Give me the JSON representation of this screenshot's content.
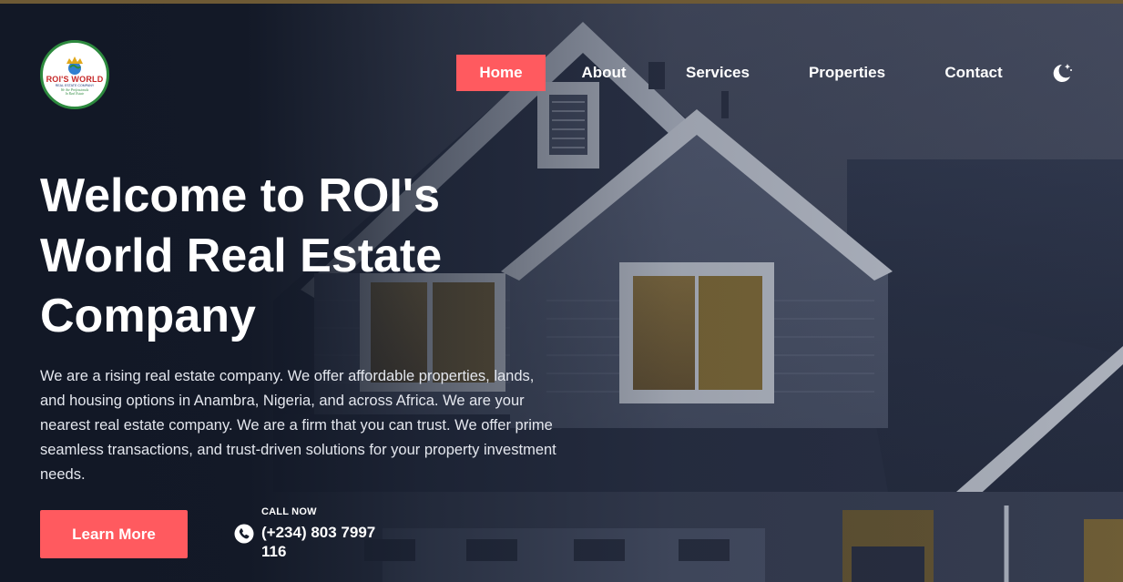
{
  "logo": {
    "brand": "ROI'S WORLD",
    "subtitle": "REAL ESTATE COMPANY",
    "tagline_line1": "We Are Professionals",
    "tagline_line2": "In Real Estate"
  },
  "nav": {
    "items": [
      {
        "label": "Home",
        "active": true
      },
      {
        "label": "About",
        "active": false
      },
      {
        "label": "Services",
        "active": false
      },
      {
        "label": "Properties",
        "active": false
      },
      {
        "label": "Contact",
        "active": false
      }
    ],
    "theme_toggle_icon": "moon-stars-icon"
  },
  "hero": {
    "title_line1": "Welcome to ROI's",
    "title_line2": "World Real Estate",
    "title_line3": "Company",
    "description": "We are a rising real estate company. We offer affordable properties, lands, and housing options in Anambra, Nigeria, and across Africa. We are your nearest real estate company. We are a firm that you can trust. We offer prime seamless transactions, and trust-driven solutions for your property investment needs.",
    "cta_label": "Learn More",
    "call_label": "CALL NOW",
    "call_number": "(+234) 803 7997 116",
    "call_icon": "phone-icon"
  },
  "colors": {
    "accent": "#ff5a5f",
    "background": "#161d2c",
    "text": "#ffffff",
    "logo_ring": "#2d8a3e"
  }
}
